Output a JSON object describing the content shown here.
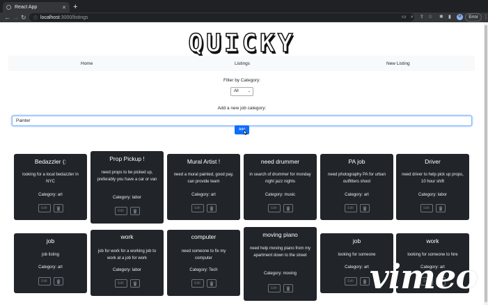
{
  "browser": {
    "tab_title": "React App",
    "url_host": "localhost",
    "url_path": ":3000/listings",
    "error_label": "Error",
    "avatar_letter": "M"
  },
  "logo_text": "QUICKY",
  "nav": {
    "home": "Home",
    "listings": "Listings",
    "new_listing": "New Listing"
  },
  "filter": {
    "label": "Filter by Category:",
    "selected": "All"
  },
  "add_category": {
    "label": "Add a new job category:",
    "value": "Painter",
    "button": "Add"
  },
  "card_buttons": {
    "edit": "Edit"
  },
  "listings": [
    {
      "title": "Bedazzler (:",
      "desc": "looking for a local bedazzler in NYC",
      "category": "Category: art"
    },
    {
      "title": "Prop Pickup !",
      "desc": "need props to be picked up, preferably you have a car or van",
      "category": "Category: labor"
    },
    {
      "title": "Mural Artist !",
      "desc": "need a mural painted, good pay, can provide team",
      "category": "Category: art"
    },
    {
      "title": "need drummer",
      "desc": "in search of drummer for monday night jazz nights",
      "category": "Category: music"
    },
    {
      "title": "PA job",
      "desc": "need photography PA for urban outfitters shoot",
      "category": "Category: art"
    },
    {
      "title": "Driver",
      "desc": "need driver to help pick up props, 10 hour shift",
      "category": "Category: labor"
    },
    {
      "title": "job",
      "desc": "job listing",
      "category": "Category: art"
    },
    {
      "title": "work",
      "desc": "job for work for a working job to work at a job for work",
      "category": "Category: labor"
    },
    {
      "title": "computer",
      "desc": "need someone to fix my computer",
      "category": "Category: Tech"
    },
    {
      "title": "moving piano",
      "desc": "need help moving piano from my apartment down to the street",
      "category": "Category: moving"
    },
    {
      "title": "job",
      "desc": "looking for someone",
      "category": "Category: art"
    },
    {
      "title": "work",
      "desc": "looking for someone to hire",
      "category": "Category: art"
    }
  ],
  "watermark": "vimeo"
}
